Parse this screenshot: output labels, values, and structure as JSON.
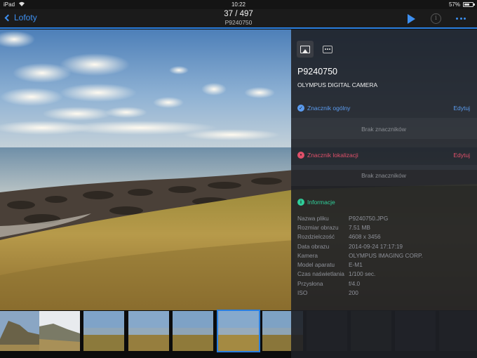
{
  "status_bar": {
    "device": "iPad",
    "time": "10:22",
    "battery": "57%"
  },
  "nav": {
    "back_label": "Lofoty",
    "counter": "37 / 497",
    "filename": "P9240750",
    "icons": {
      "back": "chevron-left-icon",
      "play": "play-icon",
      "info": "info-icon",
      "more": "more-icon"
    },
    "accent": "#3d8ff0"
  },
  "panel": {
    "tabs": [
      {
        "icon": "image-icon",
        "active": true
      },
      {
        "icon": "comment-icon",
        "active": false
      }
    ],
    "title": "P9240750",
    "description": "OLYMPUS DIGITAL CAMERA",
    "general_tags": {
      "label": "Znacznik ogólny",
      "edit": "Edytuj",
      "empty": "Brak znaczników",
      "color": "#5b9cf0"
    },
    "location_tags": {
      "label": "Znacznik lokalizacji",
      "edit": "Edytuj",
      "empty": "Brak znaczników",
      "color": "#e0506a"
    },
    "info": {
      "label": "Informacje",
      "color": "#2fcf9a",
      "rows": [
        {
          "key": "Nazwa pliku",
          "value": "P9240750.JPG"
        },
        {
          "key": "Rozmiar obrazu",
          "value": "7.51 MB"
        },
        {
          "key": "Rozdzielczość",
          "value": "4608 x 3456"
        },
        {
          "key": "Data obrazu",
          "value": "2014-09-24 17:17:19"
        },
        {
          "key": "Kamera",
          "value": "OLYMPUS IMAGING CORP."
        },
        {
          "key": "Model aparatu",
          "value": "E-M1"
        },
        {
          "key": "Czas naświetlania",
          "value": "1/100 sec."
        },
        {
          "key": "Przysłona",
          "value": "f/4.0"
        },
        {
          "key": "ISO",
          "value": "200"
        }
      ]
    }
  },
  "thumbnails": {
    "selected_index": 5
  }
}
